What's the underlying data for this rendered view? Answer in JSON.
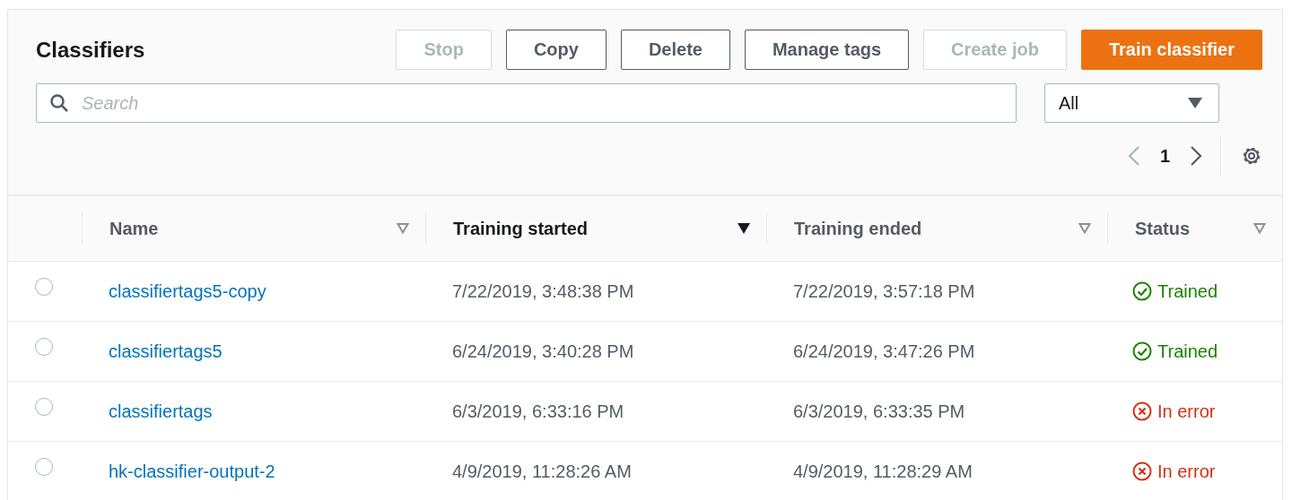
{
  "header": {
    "title": "Classifiers"
  },
  "buttons": [
    {
      "label": "Stop",
      "kind": "normal",
      "disabled": true
    },
    {
      "label": "Copy",
      "kind": "normal",
      "disabled": false
    },
    {
      "label": "Delete",
      "kind": "normal",
      "disabled": false
    },
    {
      "label": "Manage tags",
      "kind": "normal",
      "disabled": false
    },
    {
      "label": "Create job",
      "kind": "normal",
      "disabled": true
    },
    {
      "label": "Train classifier",
      "kind": "primary",
      "disabled": false
    }
  ],
  "search": {
    "placeholder": "Search"
  },
  "filter": {
    "value": "All"
  },
  "pagination": {
    "page": "1",
    "prev_disabled": true,
    "next_disabled": false
  },
  "table": {
    "columns": [
      {
        "label": "Name",
        "sorted": false
      },
      {
        "label": "Training started",
        "sorted": true
      },
      {
        "label": "Training ended",
        "sorted": false
      },
      {
        "label": "Status",
        "sorted": false
      }
    ],
    "rows": [
      {
        "selected": false,
        "name": "classifiertags5-copy",
        "started": "7/22/2019, 3:48:38 PM",
        "ended": "7/22/2019, 3:57:18 PM",
        "status": {
          "kind": "success",
          "label": "Trained"
        }
      },
      {
        "selected": false,
        "name": "classifiertags5",
        "started": "6/24/2019, 3:40:28 PM",
        "ended": "6/24/2019, 3:47:26 PM",
        "status": {
          "kind": "success",
          "label": "Trained"
        }
      },
      {
        "selected": false,
        "name": "classifiertags",
        "started": "6/3/2019, 6:33:16 PM",
        "ended": "6/3/2019, 6:33:35 PM",
        "status": {
          "kind": "error",
          "label": "In error"
        }
      },
      {
        "selected": false,
        "name": "hk-classifier-output-2",
        "started": "4/9/2019, 11:28:26 AM",
        "ended": "4/9/2019, 11:28:29 AM",
        "status": {
          "kind": "error",
          "label": "In error"
        }
      }
    ]
  }
}
